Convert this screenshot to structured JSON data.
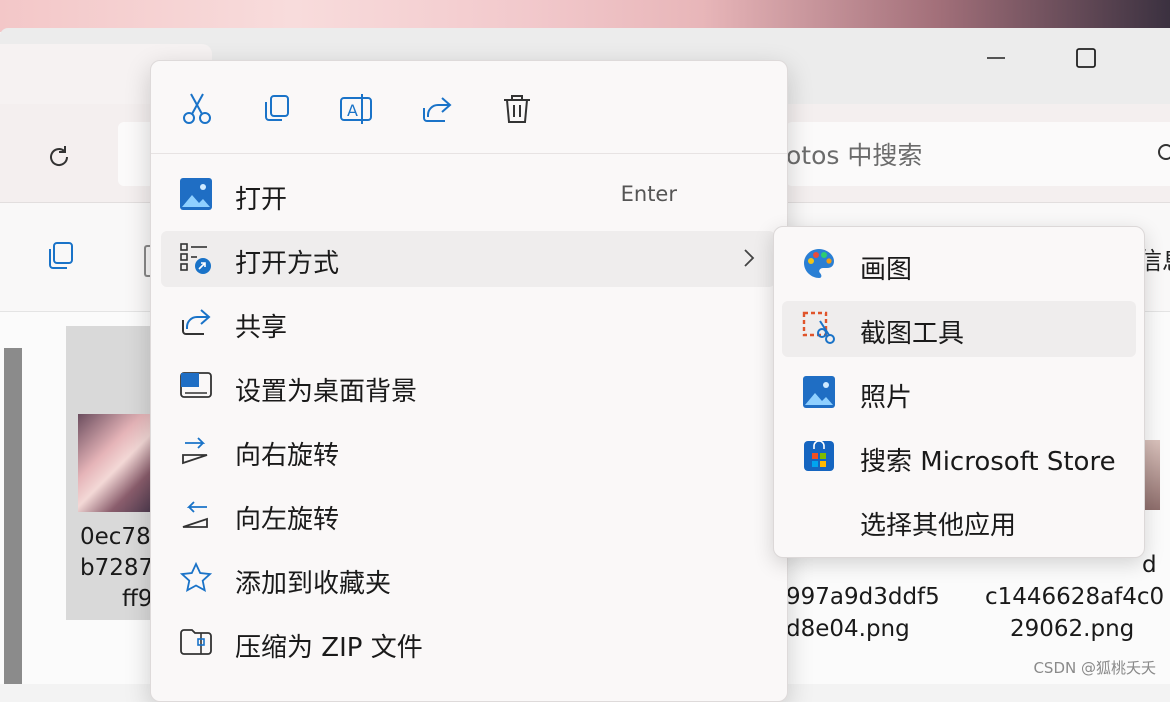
{
  "search": {
    "placeholder": "otos 中搜索"
  },
  "toolbar": {
    "info_label": "信息"
  },
  "files": {
    "left": {
      "name_lines": [
        "0ec78",
        "b7287",
        "ff9"
      ]
    },
    "middle": {
      "name_lines": [
        "997a9d3ddf5",
        "d8e04.png"
      ]
    },
    "right": {
      "name_lines": [
        "d",
        "c1446628af4c0",
        "29062.png"
      ]
    }
  },
  "context_menu": {
    "quick_actions": [
      {
        "name": "cut",
        "icon": "scissors-icon"
      },
      {
        "name": "copy",
        "icon": "copy-icon"
      },
      {
        "name": "rename",
        "icon": "rename-icon"
      },
      {
        "name": "share",
        "icon": "share-icon"
      },
      {
        "name": "delete",
        "icon": "trash-icon"
      }
    ],
    "items": [
      {
        "label": "打开",
        "shortcut": "Enter",
        "icon": "photos-app-icon"
      },
      {
        "label": "打开方式",
        "icon": "open-with-icon",
        "has_submenu": true
      },
      {
        "label": "共享",
        "icon": "share-icon"
      },
      {
        "label": "设置为桌面背景",
        "icon": "desktop-background-icon"
      },
      {
        "label": "向右旋转",
        "icon": "rotate-right-icon"
      },
      {
        "label": "向左旋转",
        "icon": "rotate-left-icon"
      },
      {
        "label": "添加到收藏夹",
        "icon": "star-icon"
      },
      {
        "label": "压缩为 ZIP 文件",
        "icon": "zip-folder-icon"
      }
    ]
  },
  "open_with_submenu": {
    "items": [
      {
        "label": "画图",
        "icon": "paint-app-icon"
      },
      {
        "label": "截图工具",
        "icon": "snipping-tool-icon"
      },
      {
        "label": "照片",
        "icon": "photos-app-icon"
      },
      {
        "label": "搜索 Microsoft Store",
        "icon": "microsoft-store-icon"
      },
      {
        "label": "选择其他应用"
      }
    ]
  },
  "watermark": "CSDN @狐桃夭夭"
}
